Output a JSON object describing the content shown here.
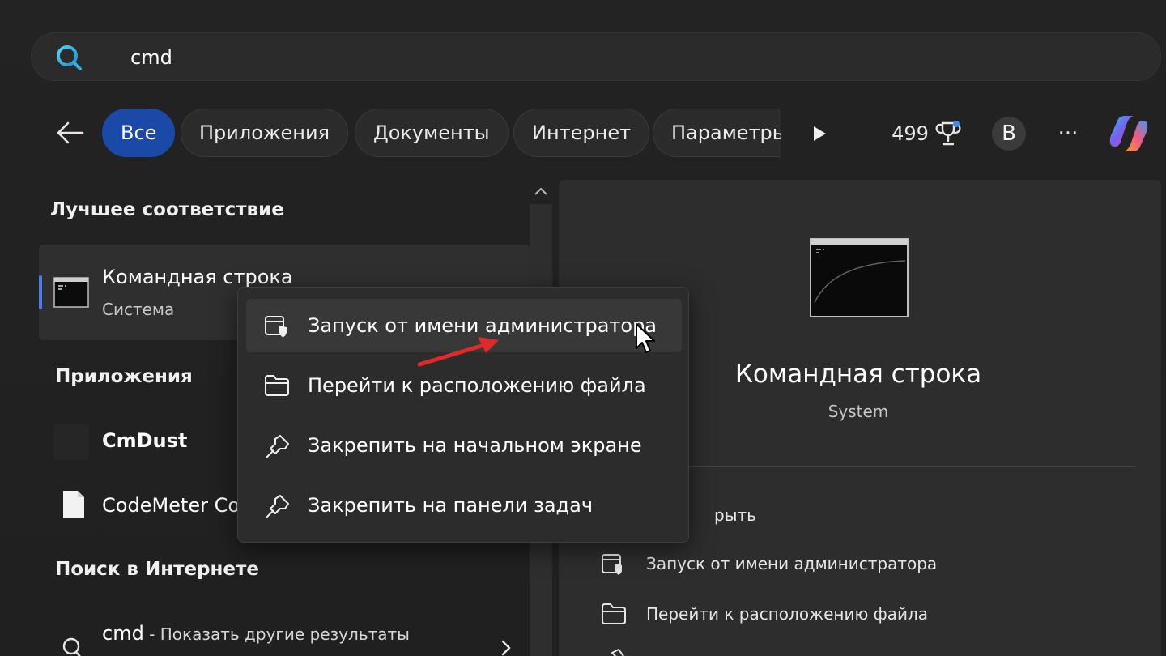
{
  "search": {
    "query": "cmd"
  },
  "filters": {
    "chips": [
      "Все",
      "Приложения",
      "Документы",
      "Интернет",
      "Параметры"
    ],
    "active": "Все"
  },
  "toolbar": {
    "points": "499",
    "avatar_letter": "B",
    "more": "···"
  },
  "sections": {
    "best_match": "Лучшее соответствие",
    "apps": "Приложения",
    "web": "Поиск в Интернете"
  },
  "best_match": {
    "name": "Командная строка",
    "type": "Система"
  },
  "apps": [
    {
      "name": "CmDust"
    },
    {
      "name": "CodeMeter Co"
    }
  ],
  "web_result": {
    "query": "cmd",
    "suffix": " - Показать другие результаты"
  },
  "context_menu": [
    {
      "label": "Запуск от имени администратора",
      "icon": "shield-admin-icon"
    },
    {
      "label": "Перейти к расположению файла",
      "icon": "folder-icon"
    },
    {
      "label": "Закрепить на начальном экране",
      "icon": "pin-icon"
    },
    {
      "label": "Закрепить на панели задач",
      "icon": "pin-icon"
    }
  ],
  "details": {
    "title": "Командная строка",
    "subtitle": "System",
    "actions": [
      {
        "label": "рыть",
        "icon": "open-icon"
      },
      {
        "label": "Запуск от имени администратора",
        "icon": "shield-admin-icon"
      },
      {
        "label": "Перейти к расположению файла",
        "icon": "folder-icon"
      }
    ]
  },
  "colors": {
    "accent": "#1a49a8",
    "annotation_arrow": "#e02a2a"
  }
}
